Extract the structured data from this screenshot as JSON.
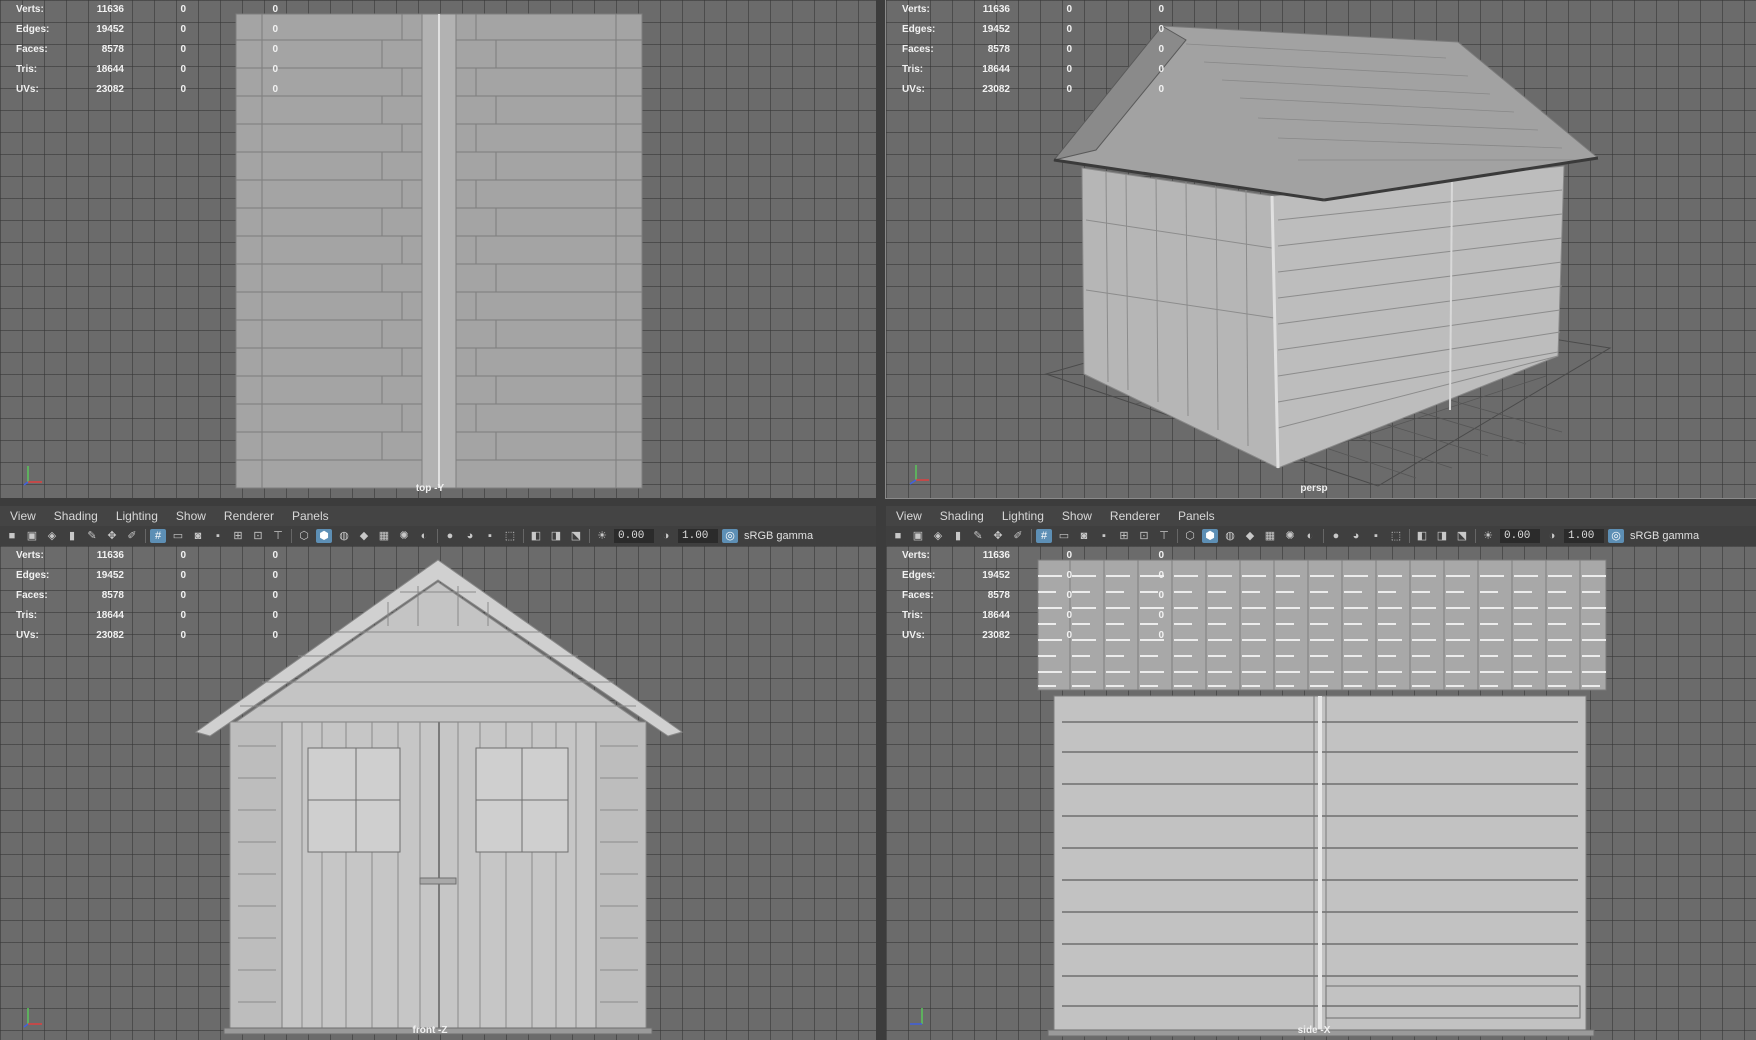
{
  "panel_menu": [
    "View",
    "Shading",
    "Lighting",
    "Show",
    "Renderer",
    "Panels"
  ],
  "toolbar": {
    "exposure_value": "0.00",
    "gamma_value": "1.00",
    "color_space": "sRGB gamma",
    "icons": [
      "camera-icon",
      "camera-attributes-icon",
      "bookmark-icon",
      "image-plane-icon",
      "grease-pencil-icon",
      "grid-icon",
      "film-gate-icon",
      "resolution-gate-icon",
      "gate-mask-icon",
      "field-chart-icon",
      "safe-action-icon",
      "wireframe-icon",
      "smooth-shade-icon",
      "textured-icon",
      "lights-icon",
      "shadows-icon",
      "ambient-occlusion-icon",
      "motion-blur-icon",
      "antialiasing-icon",
      "depth-of-field-icon",
      "isolate-select-icon",
      "xray-icon",
      "xray-joints-icon",
      "backface-icon",
      "exposure-icon",
      "gamma-icon",
      "color-management-icon"
    ]
  },
  "hud": {
    "rows": [
      {
        "label": "Verts:",
        "v1": "11636",
        "v2": "0",
        "v3": "0"
      },
      {
        "label": "Edges:",
        "v1": "19452",
        "v2": "0",
        "v3": "0"
      },
      {
        "label": "Faces:",
        "v1": "8578",
        "v2": "0",
        "v3": "0"
      },
      {
        "label": "Tris:",
        "v1": "18644",
        "v2": "0",
        "v3": "0"
      },
      {
        "label": "UVs:",
        "v1": "23082",
        "v2": "0",
        "v3": "0"
      }
    ]
  },
  "viewports": {
    "top": {
      "camera": "top -Y"
    },
    "persp": {
      "camera": "persp"
    },
    "front": {
      "camera": "front -Z"
    },
    "side": {
      "camera": "side -X"
    }
  },
  "colors": {
    "accent": "#5d8fb5",
    "model": "#bdbdbd",
    "viewport_bg": "#6b6b6b"
  }
}
